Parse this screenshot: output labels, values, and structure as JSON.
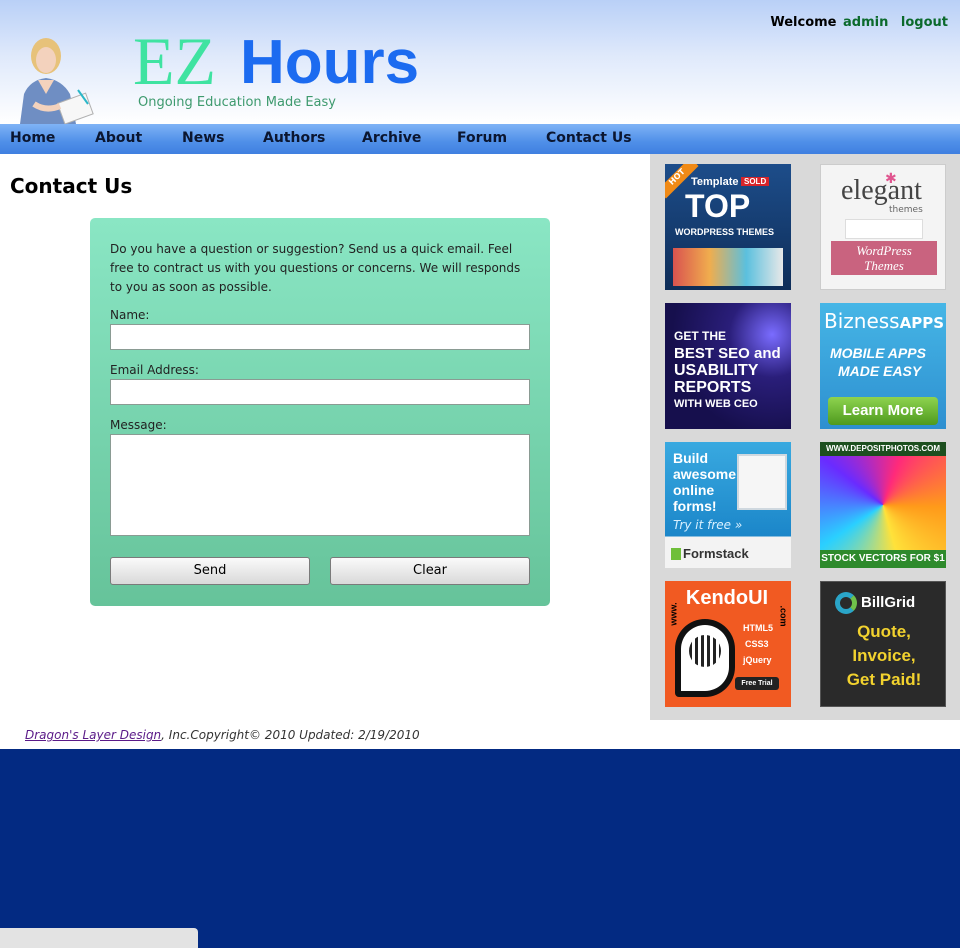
{
  "header": {
    "logo_ez": "EZ",
    "logo_hours": "Hours",
    "tagline": "Ongoing Education Made Easy",
    "welcome_text": "Welcome",
    "username": "admin",
    "logout": "logout"
  },
  "nav": {
    "items": [
      "Home",
      "About",
      "News",
      "Authors",
      "Archive",
      "Forum",
      "Contact Us"
    ]
  },
  "page": {
    "title": "Contact Us"
  },
  "form": {
    "intro": "Do you have a question or suggestion? Send us a quick email. Feel free to contract us with you questions or concerns. We will responds to you as soon as possible.",
    "name_label": "Name:",
    "name_value": "",
    "email_label": "Email Address:",
    "email_value": "",
    "message_label": "Message:",
    "message_value": "",
    "send_label": "Send",
    "clear_label": "Clear"
  },
  "ads": {
    "ad1": {
      "badge": "HOT",
      "line1": "Template",
      "sold": "SOLD",
      "line2": "TOP",
      "line3": "WORDPRESS THEMES"
    },
    "ad2": {
      "brand": "elegant",
      "sub": "themes",
      "ribbon1": "WordPress",
      "ribbon2": "Themes"
    },
    "ad3": {
      "line1": "GET THE",
      "line2": "BEST SEO and",
      "line3": "USABILITY",
      "line4": "REPORTS",
      "line5": "WITH WEB CEO"
    },
    "ad4": {
      "brand1": "Bizness",
      "brand2": "APPS",
      "line1": "MOBILE APPS",
      "line2": "MADE EASY",
      "button": "Learn More"
    },
    "ad5": {
      "line1": "Build",
      "line2": "awesome",
      "line3": "online",
      "line4": "forms!",
      "line5": "Try it free »",
      "brand": "Formstack"
    },
    "ad6": {
      "top": "WWW.DEPOSITPHOTOS.COM",
      "bottom": "STOCK VECTORS FOR $1"
    },
    "ad7": {
      "brand": "KendoUI",
      "url": ".com",
      "www": "www.",
      "t1": "HTML5",
      "t2": "CSS3",
      "t3": "jQuery",
      "trial": "Free Trial"
    },
    "ad8": {
      "brand": "BillGrid",
      "l1": "Quote,",
      "l2": "Invoice,",
      "l3": "Get Paid!"
    }
  },
  "footer": {
    "link": "Dragon's Layer Design",
    "text": ", Inc.Copyright© 2010 Updated: 2/19/2010"
  },
  "colors": {
    "page_bg": "#032a82",
    "nav_blue": "#4f8fe8",
    "form_green": "#7ad8b4",
    "sidebar_gray": "#d9d9d9"
  }
}
